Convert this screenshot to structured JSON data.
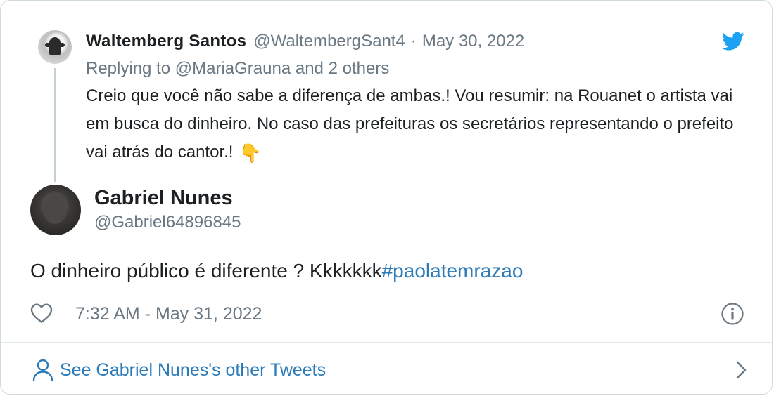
{
  "parent_tweet": {
    "author_name": "Waltemberg Santos",
    "author_handle": "@WaltembergSant4",
    "separator": "·",
    "date": "May 30, 2022",
    "replying_prefix": "Replying to ",
    "replying_mention": "@MariaGrauna",
    "replying_suffix": " and 2 others",
    "text": "Creio que você não sabe a diferença de ambas.! Vou resumir: na Rouanet o artista vai em busca do dinheiro. No caso das prefeituras os secretários representando o prefeito vai atrás do cantor.!",
    "emoji": "👇"
  },
  "main_tweet": {
    "author_name": "Gabriel Nunes",
    "author_handle": "@Gabriel64896845",
    "text": "O dinheiro público é diferente ? Kkkkkkk",
    "hashtag": "#paolatemrazao",
    "timestamp": "7:32 AM - May 31, 2022"
  },
  "footer": {
    "link_label": "See Gabriel Nunes's other Tweets"
  },
  "icons": {
    "brand": "twitter-bird-icon",
    "like": "heart-icon",
    "info": "info-icon",
    "profile": "user-icon",
    "more": "chevron-right-icon"
  },
  "colors": {
    "twitter_blue": "#1da1f2",
    "link_blue": "#2b7bb9",
    "secondary_text": "#697882",
    "primary_text": "#1c2022",
    "border": "#cfd9de"
  }
}
